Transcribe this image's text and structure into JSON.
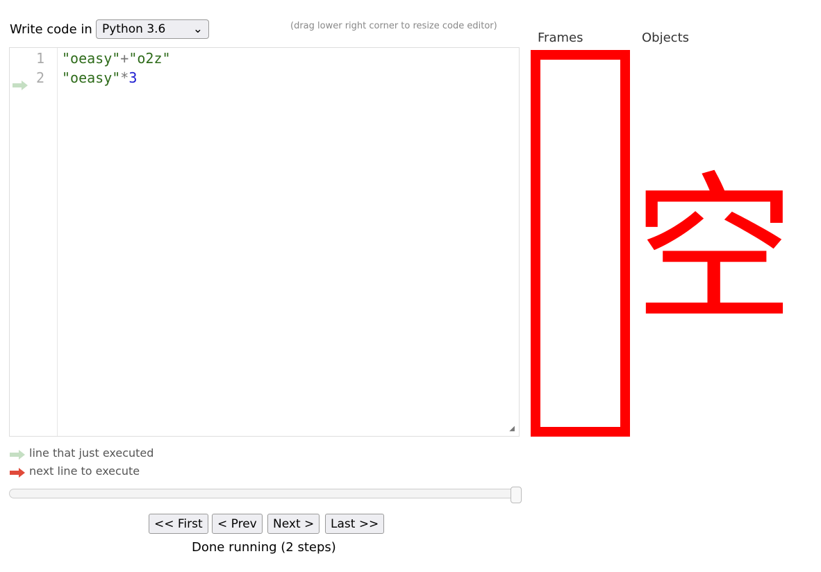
{
  "header": {
    "write_code_label": "Write code in",
    "language": "Python 3.6",
    "resize_hint": "(drag lower right corner to resize code editor)"
  },
  "editor": {
    "lines": [
      {
        "number": "1",
        "tokens": [
          {
            "text": "\"oeasy\"",
            "kind": "str"
          },
          {
            "text": "+",
            "kind": "op"
          },
          {
            "text": "\"o2z\"",
            "kind": "str"
          }
        ]
      },
      {
        "number": "2",
        "tokens": [
          {
            "text": "\"oeasy\"",
            "kind": "str"
          },
          {
            "text": "*",
            "kind": "op"
          },
          {
            "text": "3",
            "kind": "num"
          }
        ]
      }
    ],
    "current_line_marker": "2"
  },
  "legend": {
    "just_executed": "line that just executed",
    "next_line": "next line to execute"
  },
  "colors": {
    "just_executed_arrow": "#c5dfc3",
    "next_line_arrow": "#e04a3a",
    "annotation": "#ff0000"
  },
  "slider": {
    "position_fraction": 1.0
  },
  "nav": {
    "first": "<< First",
    "prev": "< Prev",
    "next": "Next >",
    "last": "Last >>"
  },
  "status": "Done running (2 steps)",
  "viz": {
    "frames_label": "Frames",
    "objects_label": "Objects"
  },
  "annotation": {
    "text": "空"
  }
}
